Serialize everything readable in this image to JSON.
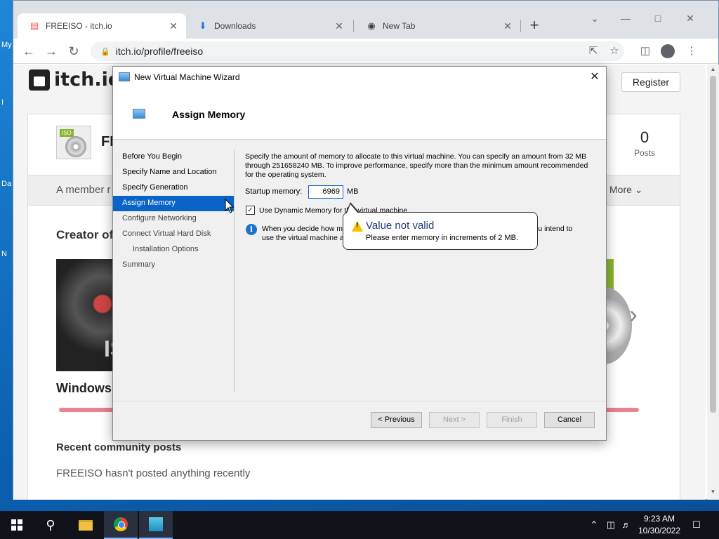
{
  "desktop": {
    "labels": [
      "My",
      "I",
      "Da",
      "N"
    ]
  },
  "browser": {
    "tabs": [
      {
        "label": "FREEISO - itch.io",
        "icon": "itch-icon",
        "active": true
      },
      {
        "label": "Downloads",
        "icon": "download-icon",
        "active": false
      },
      {
        "label": "New Tab",
        "icon": "chrome-icon",
        "active": false
      }
    ],
    "url": "itch.io/profile/freeiso"
  },
  "page": {
    "logo": "itch.io",
    "register_label": "Register",
    "profile_name": "FR",
    "posts_count": "0",
    "posts_label": "Posts",
    "member_text": "A member r",
    "more_label": "More",
    "creator_title": "Creator of",
    "game_title": "Windows",
    "game_letters": "IS",
    "recent_title": "Recent community posts",
    "recent_text": "FREEISO hasn't posted anything recently"
  },
  "wizard": {
    "title": "New Virtual Machine Wizard",
    "heading": "Assign Memory",
    "nav": [
      {
        "label": "Before You Begin",
        "state": "normal"
      },
      {
        "label": "Specify Name and Location",
        "state": "normal"
      },
      {
        "label": "Specify Generation",
        "state": "normal"
      },
      {
        "label": "Assign Memory",
        "state": "selected"
      },
      {
        "label": "Configure Networking",
        "state": "inactive"
      },
      {
        "label": "Connect Virtual Hard Disk",
        "state": "inactive"
      },
      {
        "label": "Installation Options",
        "state": "inactive-sub"
      },
      {
        "label": "Summary",
        "state": "inactive"
      }
    ],
    "description": "Specify the amount of memory to allocate to this virtual machine. You can specify an amount from 32 MB through 251658240 MB. To improve performance, specify more than the minimum amount recommended for the operating system.",
    "startup_memory_label": "Startup memory:",
    "startup_memory_value": "6969",
    "memory_unit": "MB",
    "dynamic_memory_label": "Use Dynamic Memory for this virtual machine.",
    "dynamic_memory_checked": true,
    "info_text": "When you decide how much memory to assign to a virtual machine, consider how you intend to use the virtual machine and the operating system that it will run.",
    "buttons": {
      "previous": "< Previous",
      "next": "Next >",
      "finish": "Finish",
      "cancel": "Cancel"
    }
  },
  "tooltip": {
    "title": "Value not valid",
    "message": "Please enter memory in increments of 2 MB."
  },
  "taskbar": {
    "time": "9:23 AM",
    "date": "10/30/2022"
  },
  "colors": {
    "selection_blue": "#0a64c8",
    "itch_pink": "#e8838f",
    "warning_yellow": "#f2c200"
  }
}
